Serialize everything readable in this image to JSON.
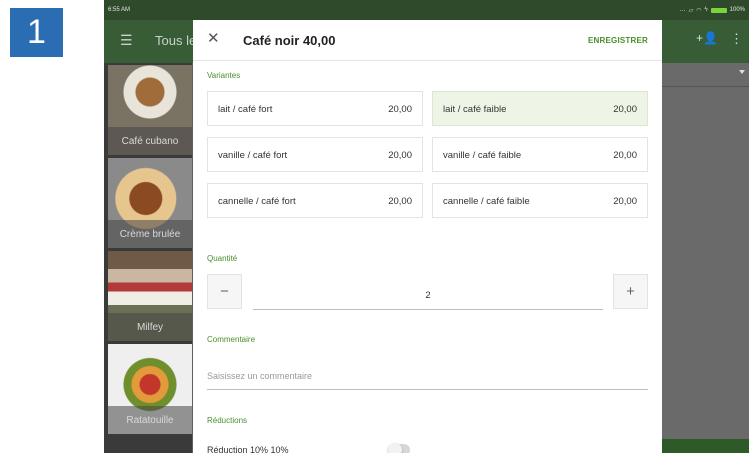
{
  "step_number": "1",
  "status_bar": {
    "time": "6:55 AM",
    "battery": "100%"
  },
  "app_bar": {
    "title": "Tous le"
  },
  "product_tiles": [
    {
      "label": "Café cubano"
    },
    {
      "label": "Crème brulée"
    },
    {
      "label": "Milfey"
    },
    {
      "label": "Ratatouille"
    }
  ],
  "dialog": {
    "title": "Café noir 40,00",
    "save_label": "ENREGISTRER",
    "variants_label": "Variantes",
    "variants": [
      {
        "name": "lait / café fort",
        "price": "20,00",
        "selected": false
      },
      {
        "name": "lait / café faible",
        "price": "20,00",
        "selected": true
      },
      {
        "name": "vanille / café fort",
        "price": "20,00",
        "selected": false
      },
      {
        "name": "vanille / café faible",
        "price": "20,00",
        "selected": false
      },
      {
        "name": "cannelle / café fort",
        "price": "20,00",
        "selected": false
      },
      {
        "name": "cannelle / café faible",
        "price": "20,00",
        "selected": false
      }
    ],
    "quantity_label": "Quantité",
    "quantity": "2",
    "decrement_label": "−",
    "increment_label": "+",
    "comment_label": "Commentaire",
    "comment_placeholder": "Saisissez un commentaire",
    "comment_value": "",
    "reductions_label": "Réductions",
    "reduction_item": "Réduction 10% 10%",
    "reduction_enabled": false
  },
  "colors": {
    "accent": "#4a8f2a",
    "app_bar": "#385c35",
    "selected_variant": "#eff5e6",
    "step_badge": "#2a6db3"
  }
}
